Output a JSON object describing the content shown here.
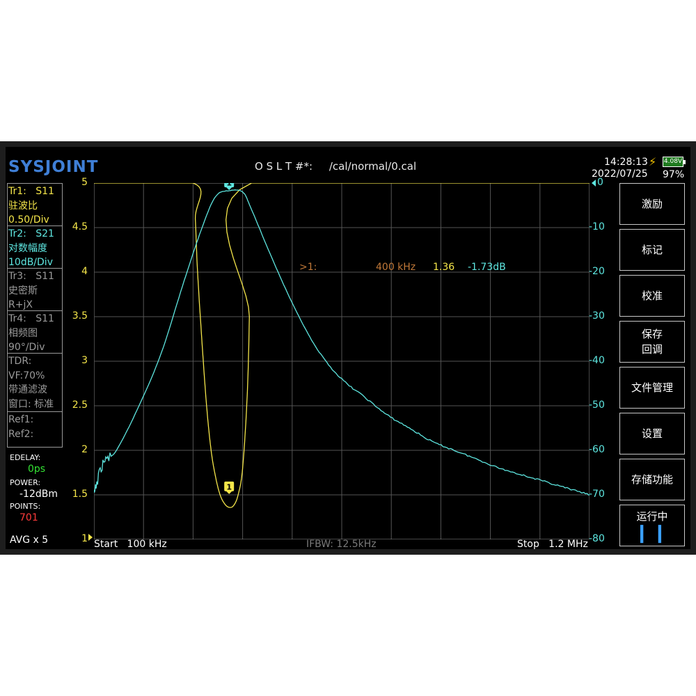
{
  "header": {
    "logo": "SYSJOINT",
    "cal_title": "O S L T #*:     /cal/normal/0.cal",
    "time": "14:28:13",
    "date": "2022/07/25",
    "battery_voltage": "4.08V",
    "battery_percent": "97%",
    "charging_icon": "lightning-bolt-icon"
  },
  "traces": [
    {
      "id": "Tr1:",
      "param": "S11",
      "format": "驻波比",
      "scale": "0.50/Div",
      "color": "#f5e64a",
      "active": true
    },
    {
      "id": "Tr2:",
      "param": "S21",
      "format": "对数幅度",
      "scale": "10dB/Div",
      "color": "#5ee6e0",
      "active": true
    },
    {
      "id": "Tr3:",
      "param": "S11",
      "format": "史密斯",
      "scale": "R+jX",
      "color": "#9a9a9a",
      "active": false
    },
    {
      "id": "Tr4:",
      "param": "S11",
      "format": "相频图",
      "scale": "90°/Div",
      "color": "#9a9a9a",
      "active": false
    }
  ],
  "tdr": {
    "line1": "TDR:",
    "line2": "VF:70%",
    "line3": "带通滤波",
    "line4": "窗口: 标准"
  },
  "refs": {
    "ref1": "Ref1:",
    "ref2": "Ref2:"
  },
  "settings": {
    "edelay_label": "EDELAY:",
    "edelay_value": "0ps",
    "power_label": "POWER:",
    "power_value": "-12dBm",
    "points_label": "POINTS:",
    "points_value": "701",
    "avg": "AVG x 5"
  },
  "axes": {
    "left_ticks": [
      "5",
      "4.5",
      "4",
      "3.5",
      "3",
      "2.5",
      "2",
      "1.5",
      "1"
    ],
    "right_ticks": [
      "0",
      "-10",
      "-20",
      "-30",
      "-40",
      "-50",
      "-60",
      "-70",
      "-80"
    ]
  },
  "footer": {
    "start": "Start   100 kHz",
    "ifbw": "IFBW: 12.5kHz",
    "stop": "Stop   1.2 MHz"
  },
  "marker": {
    "label": ">1:",
    "freq": "400 kHz",
    "swr": "1.36",
    "s21": "-1.73dB",
    "number": "1"
  },
  "menu": {
    "stimulus": "激励",
    "marker": "标记",
    "calibrate": "校准",
    "save_line1": "保存",
    "save_line2": "回调",
    "file_manager": "文件管理",
    "settings": "设置",
    "storage": "存储功能",
    "running": "运行中",
    "pause_icon": "pause-icon"
  },
  "chart_data": [
    {
      "type": "line",
      "title": "",
      "xlabel": "",
      "x_unit": "kHz",
      "xlim": [
        100,
        1200
      ],
      "series": [
        {
          "name": "Tr1: S11 驻波比",
          "axis": "left",
          "ylim": [
            1,
            5
          ],
          "color": "#f5e64a",
          "x": [
            100,
            320,
            325,
            330,
            340,
            350,
            360,
            370,
            380,
            390,
            400,
            410,
            420,
            430,
            440,
            445,
            450,
            1200
          ],
          "y": [
            5,
            5,
            4.6,
            4.0,
            3.2,
            2.5,
            2.0,
            1.7,
            1.5,
            1.4,
            1.36,
            1.38,
            1.5,
            1.8,
            2.6,
            3.5,
            5,
            5
          ]
        },
        {
          "name": "Tr2: S21 对数幅度",
          "axis": "right",
          "ylim": [
            -80,
            0
          ],
          "color": "#5ee6e0",
          "x": [
            100,
            120,
            150,
            200,
            250,
            300,
            340,
            370,
            400,
            430,
            450,
            500,
            550,
            600,
            650,
            700,
            750,
            800,
            850,
            900,
            950,
            1000,
            1050,
            1100,
            1150,
            1200
          ],
          "y": [
            -70,
            -63,
            -60,
            -50,
            -38,
            -22,
            -10,
            -3,
            -1.73,
            -2,
            -6,
            -18,
            -29,
            -38,
            -44,
            -48,
            -52,
            -55,
            -58,
            -60,
            -62,
            -64,
            -65.5,
            -67,
            -68.5,
            -70
          ]
        }
      ]
    }
  ]
}
